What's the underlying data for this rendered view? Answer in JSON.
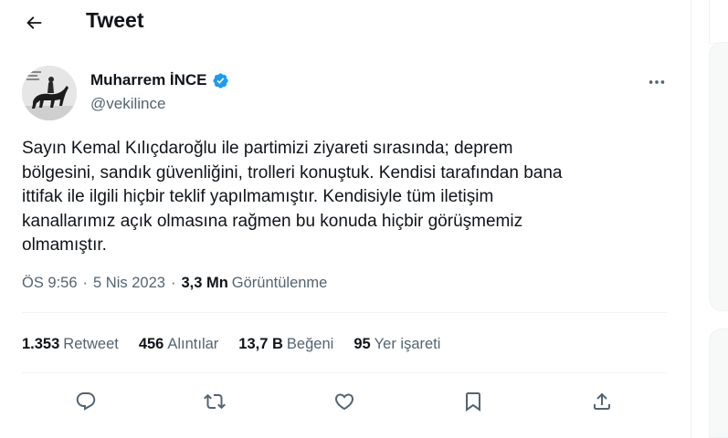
{
  "header": {
    "title": "Tweet",
    "back_icon": "arrow-left-icon"
  },
  "author": {
    "name": "Muharrem İNCE",
    "handle": "@vekilince",
    "verified_color": "#1d9bf0",
    "avatar_icon": "profile-photo-horseback-icon"
  },
  "tweet": {
    "text": "Sayın Kemal Kılıçdaroğlu ile partimizi ziyareti sırasında; deprem\nbölgesini, sandık güvenliğini, trolleri konuştuk. Kendisi tarafından bana\nittifak ile ilgili hiçbir teklif yapılmamıştır. Kendisiyle tüm iletişim\nkanallarımız açık olmasına rağmen bu konuda hiçbir görüşmemiz\nolmamıştır.",
    "time": "ÖS 9:56",
    "date": "5 Nis 2023",
    "separator": "·",
    "views_count": "3,3 Mn",
    "views_label": "Görüntülenme"
  },
  "stats": [
    {
      "count": "1.353",
      "label": "Retweet"
    },
    {
      "count": "456",
      "label": "Alıntılar"
    },
    {
      "count": "13,7 B",
      "label": "Beğeni"
    },
    {
      "count": "95",
      "label": "Yer işareti"
    }
  ],
  "actions": [
    {
      "name": "reply-icon"
    },
    {
      "name": "retweet-icon"
    },
    {
      "name": "like-icon"
    },
    {
      "name": "bookmark-icon"
    },
    {
      "name": "share-icon"
    }
  ],
  "colors": {
    "text_primary": "#0f1419",
    "text_secondary": "#536471",
    "border": "#eff3f4",
    "accent": "#1d9bf0"
  }
}
